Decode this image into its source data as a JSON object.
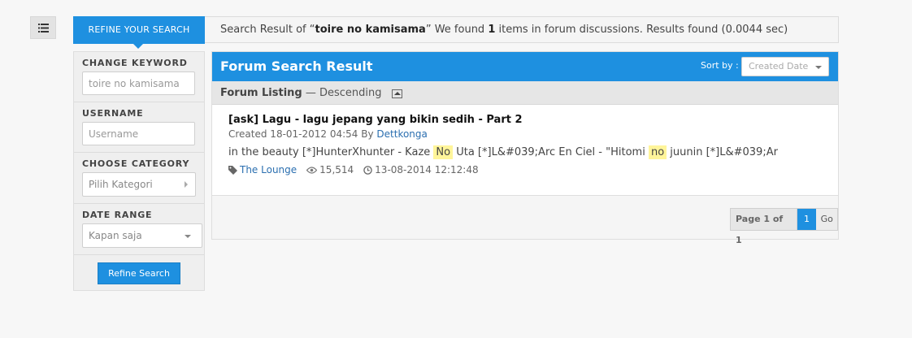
{
  "menu": {
    "icon": "list-icon"
  },
  "topbar": {
    "refine_tab": "REFINE YOUR SEARCH",
    "summary_prefix": "Search Result of “",
    "query": "toire no kamisama",
    "summary_mid": "” We found ",
    "count": "1",
    "summary_suffix": " items in forum discussions. Results found (0.0044 sec)"
  },
  "sidebar": {
    "keyword_label": "CHANGE KEYWORD",
    "keyword_placeholder": "toire no kamisama",
    "username_label": "USERNAME",
    "username_placeholder": "Username",
    "category_label": "CHOOSE CATEGORY",
    "category_value": "Pilih Kategori",
    "date_label": "DATE RANGE",
    "date_value": "Kapan saja",
    "refine_button": "Refine Search"
  },
  "panel": {
    "title": "Forum Search Result",
    "sort_label": "Sort by :",
    "sort_value": "Created Date",
    "listing_label": "Forum Listing",
    "listing_sub": " — Descending"
  },
  "results": [
    {
      "title": "[ask] Lagu - lagu jepang yang bikin sedih - Part 2",
      "created_prefix": "Created 18-01-2012 04:54 By ",
      "author": "Dettkonga",
      "excerpt_1": "in the beauty [*]HunterXhunter - Kaze ",
      "hl_1": "No",
      "excerpt_2": " Uta [*]L&#039;Arc En Ciel - \"Hitomi ",
      "hl_2": "no",
      "excerpt_3": " juunin [*]L&#039;Ar",
      "tag": "The Lounge",
      "views": "15,514",
      "date": "13-08-2014 12:12:48"
    }
  ],
  "pager": {
    "info": "Page 1 of 1",
    "current": "1",
    "go": "Go"
  },
  "colors": {
    "accent": "#1e90e0",
    "highlight": "#fff59a",
    "link": "#2b6fb0"
  }
}
